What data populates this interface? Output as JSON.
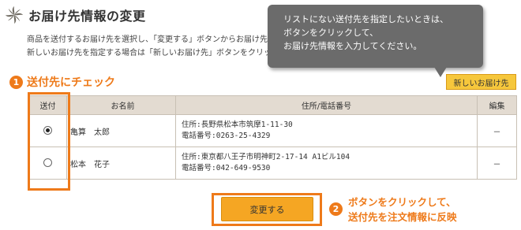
{
  "header": {
    "title": "お届け先情報の変更",
    "icon": "pinwheel-icon"
  },
  "description": {
    "line1": "商品を送付するお届け先を選択し、「変更する」ボタンからお届け先を注",
    "line2": "新しいお届け先を指定する場合は「新しいお届け先」ボタンをクリックし"
  },
  "tooltip": {
    "line1": "リストにない送付先を指定したいときは、",
    "line2": "ボタンをクリックして、",
    "line3": "お届け先情報を入力してください。"
  },
  "new_address_button": {
    "label": "新しいお届け先"
  },
  "step1": {
    "number": "1",
    "text": "送付先にチェック"
  },
  "table": {
    "headers": {
      "radio": "送付",
      "name": "お名前",
      "address": "住所/電話番号",
      "edit": "編集"
    },
    "rows": [
      {
        "selected": true,
        "name": "亀算　太郎",
        "address": "住所:長野県松本市筑摩1-11-30",
        "phone": "電話番号:0263-25-4329",
        "edit": "－"
      },
      {
        "selected": false,
        "name": "松本　花子",
        "address": "住所:東京都八王子市明神町2-17-14 A1ビル104",
        "phone": "電話番号:042-649-9530",
        "edit": "－"
      }
    ]
  },
  "change_button": {
    "label": "変更する"
  },
  "step2": {
    "number": "2",
    "line1": "ボタンをクリックして、",
    "line2": "送付先を注文情報に反映"
  },
  "colors": {
    "accent": "#ee7a1a",
    "button": "#f5a623",
    "tooltip_bg": "#6b6b6b",
    "table_header_bg": "#e3dbd1"
  }
}
